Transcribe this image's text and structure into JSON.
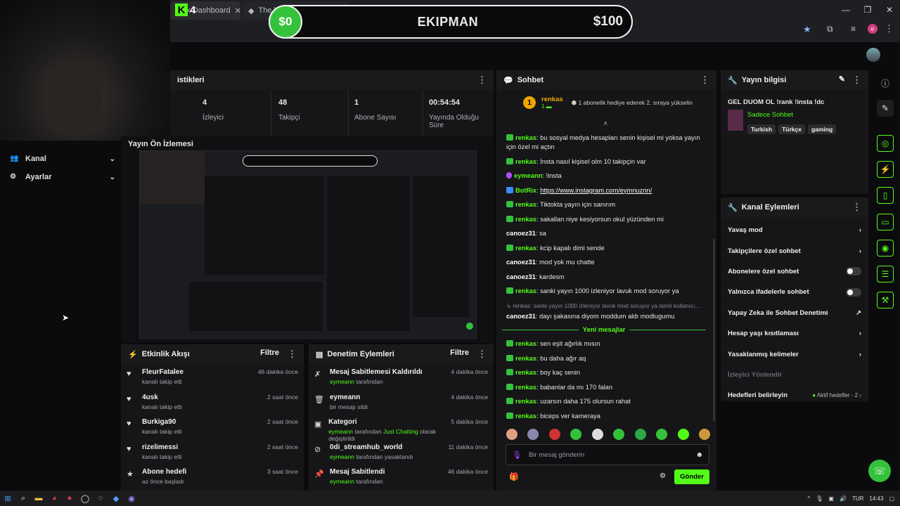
{
  "browser": {
    "tabs": [
      {
        "label": "Kick Dashboard"
      },
      {
        "label": "The best Chat and Widgets"
      }
    ],
    "new_tab": "+",
    "window_controls": [
      "—",
      "❐",
      "✕"
    ]
  },
  "stream_overlay": {
    "logo_letter": "K",
    "logo_count": "4",
    "left_amount": "$0",
    "title": "EKIPMAN",
    "right_amount": "$100"
  },
  "sidebar": {
    "items": [
      {
        "label": "Kanal",
        "icon": "users-icon"
      },
      {
        "label": "Ayarlar",
        "icon": "gear-icon"
      }
    ]
  },
  "stats": {
    "header": "istikleri",
    "items": [
      {
        "value": "4",
        "label": "İzleyici"
      },
      {
        "value": "48",
        "label": "Takipçi"
      },
      {
        "value": "1",
        "label": "Abone Sayısı"
      },
      {
        "value": "00:54:54",
        "label": "Yayında Olduğu Süre"
      }
    ]
  },
  "preview": {
    "title": "Yayın Ön İzlemesi"
  },
  "activity_feed": {
    "title": "Etkinlik Akışı",
    "filter": "Filtre",
    "items": [
      {
        "name": "FleurFatalee",
        "sub": "kanalı takip etti",
        "time": "46 dakika önce"
      },
      {
        "name": "4usk",
        "sub": "kanalı takip etti",
        "time": "2 saat önce"
      },
      {
        "name": "Burkiga90",
        "sub": "kanalı takip etti",
        "time": "2 saat önce"
      },
      {
        "name": "rizelimessi",
        "sub": "kanalı takip etti",
        "time": "2 saat önce"
      },
      {
        "name": "Abone hedefi",
        "sub": "az önce başladı",
        "time": "3 saat önce"
      }
    ]
  },
  "moderation": {
    "title": "Denetim Eylemleri",
    "filter": "Filtre",
    "items": [
      {
        "title": "Mesaj Sabitlemesi Kaldırıldı",
        "user": "eymeann",
        "rest": " tarafından",
        "time": "4 dakika önce"
      },
      {
        "title": "eymeann",
        "user": "",
        "rest": "bir mesajı sildi",
        "time": "4 dakika önce"
      },
      {
        "title": "Kategori",
        "user": "eymeann",
        "rest": " tarafından ",
        "extra": "Just Chatting",
        "rest2": " olarak değiştirildi",
        "time": "5 dakika önce"
      },
      {
        "title": "0di_streamhub_world",
        "user": "eymeann",
        "rest": " tarafından yasaklandı",
        "time": "11 dakika önce"
      },
      {
        "title": "Mesaj Sabitlendi",
        "user": "eymeann",
        "rest": " tarafından",
        "time": "46 dakika önce"
      }
    ]
  },
  "chat": {
    "title": "Sohbet",
    "pinned_user": "renkas",
    "pinned_rank": "1",
    "pinned_text": "1 abonelik hediye ederek 2. sıraya yükselin",
    "new_messages": "Yeni mesajlar",
    "reply_preview": "↳ renkas: sanki yayın 1000 izleniyor lavuk mod soruyor ya isimli kullanıcı...",
    "messages_before": [
      {
        "user": "renkas",
        "text": "bu sosyal medya hesapları senin kişisel mi yoksa yayın için özel mi açtın",
        "color": "green"
      },
      {
        "user": "renkas",
        "text": "İnsta nasıl kişisel olm 10 takipçin var",
        "color": "green"
      },
      {
        "user": "eymeann",
        "text": "!insta",
        "color": "green",
        "badge": "mic"
      },
      {
        "user": "BotRix",
        "text": "https://www.instagram.com/eymnuznn/",
        "color": "green",
        "badge": "bot",
        "link": true
      },
      {
        "user": "renkas",
        "text": "Tiktokta yayın için sanırım",
        "color": "green"
      },
      {
        "user": "renkas",
        "text": "sakallan niye kesiyorsun okul yüzünden mi",
        "color": "green"
      },
      {
        "user": "canoez31",
        "text": "sa",
        "color": "white"
      },
      {
        "user": "renkas",
        "text": "kcip kapalı dimi sende",
        "color": "green"
      },
      {
        "user": "canoez31",
        "text": "mod yok mu chatte",
        "color": "white"
      },
      {
        "user": "canoez31",
        "text": "kardesm",
        "color": "white"
      },
      {
        "user": "renkas",
        "text": "sanki yayın 1000 izleniyor lavuk mod soruyor ya",
        "color": "green"
      },
      {
        "user": "canoez31",
        "text": "dayı şakasına diyom moddum aldı modlugumu",
        "color": "white"
      }
    ],
    "messages_after": [
      {
        "user": "renkas",
        "text": "sen eşit ağırlık mısın"
      },
      {
        "user": "renkas",
        "text": "bu daha ağır aq"
      },
      {
        "user": "renkas",
        "text": "boy kaç senin"
      },
      {
        "user": "renkas",
        "text": "babanlar da mı 170 falan"
      },
      {
        "user": "renkas",
        "text": "uzarsın daha 175 olursun rahat"
      },
      {
        "user": "renkas",
        "text": "biceps ver kameraya"
      }
    ],
    "input_placeholder": "Bir mesaj gönderin",
    "send": "Gönder"
  },
  "stream_info": {
    "title": "Yayın bilgisi",
    "stream_title": "GEL DUOM OL !rank !insta !dc",
    "category": "Sadece Sohbet",
    "tags": [
      "Turkish",
      "Türkçe",
      "gaming"
    ]
  },
  "channel_actions": {
    "title": "Kanal Eylemleri",
    "items": [
      {
        "label": "Yavaş mod",
        "control": "chevron"
      },
      {
        "label": "Takipçilere özel sohbet",
        "control": "chevron"
      },
      {
        "label": "Abonelere özel sohbet",
        "control": "toggle"
      },
      {
        "label": "Yalnızca ifadelerle sohbet",
        "control": "toggle"
      },
      {
        "label": "Yapay Zeka ile Sohbet Denetimi",
        "control": "external"
      },
      {
        "label": "Hesap yaşı kısıtlaması",
        "control": "chevron"
      },
      {
        "label": "Yasaklanmış kelimeler",
        "control": "chevron"
      },
      {
        "label": "İzleyici Yönlendir",
        "control": "none"
      },
      {
        "label": "Hedefleri belirleyin",
        "control": "chevron",
        "extra": "Aktif hedefler - 2"
      }
    ]
  },
  "taskbar": {
    "lang": "TUR",
    "time": "14:43"
  },
  "colors": {
    "accent": "#53fc18",
    "panel": "#161618",
    "bg": "#0b0b0d"
  }
}
